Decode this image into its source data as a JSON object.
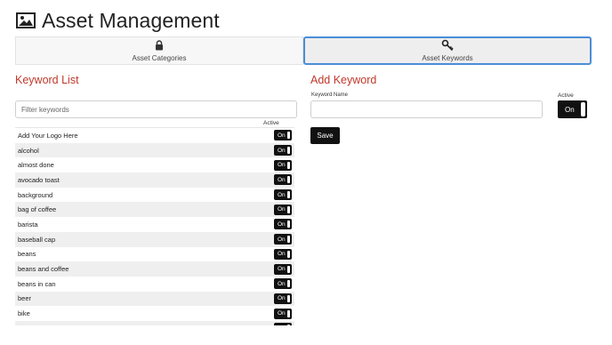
{
  "header": {
    "title": "Asset Management",
    "icon": "image-icon"
  },
  "tabs": [
    {
      "label": "Asset Categories",
      "icon": "lock-icon",
      "active": false
    },
    {
      "label": "Asset Keywords",
      "icon": "key-icon",
      "active": true
    }
  ],
  "keyword_list": {
    "title": "Keyword List",
    "filter_placeholder": "Filter keywords",
    "active_header": "Active",
    "items": [
      {
        "name": "Add Your Logo Here",
        "active": "On"
      },
      {
        "name": "alcohol",
        "active": "On"
      },
      {
        "name": "almost done",
        "active": "On"
      },
      {
        "name": "avocado toast",
        "active": "On"
      },
      {
        "name": "background",
        "active": "On"
      },
      {
        "name": "bag of coffee",
        "active": "On"
      },
      {
        "name": "barista",
        "active": "On"
      },
      {
        "name": "baseball cap",
        "active": "On"
      },
      {
        "name": "beans",
        "active": "On"
      },
      {
        "name": "beans and coffee",
        "active": "On"
      },
      {
        "name": "beans in can",
        "active": "On"
      },
      {
        "name": "beer",
        "active": "On"
      },
      {
        "name": "bike",
        "active": "On"
      },
      {
        "name": "",
        "active": ""
      }
    ]
  },
  "add_keyword": {
    "title": "Add Keyword",
    "name_label": "Keyword Name",
    "name_value": "",
    "active_label": "Active",
    "active_value": "On",
    "save_label": "Save"
  },
  "colors": {
    "accent_red": "#c0392b",
    "tab_active_border": "#4a8dd8",
    "toggle_bg": "#111111"
  }
}
